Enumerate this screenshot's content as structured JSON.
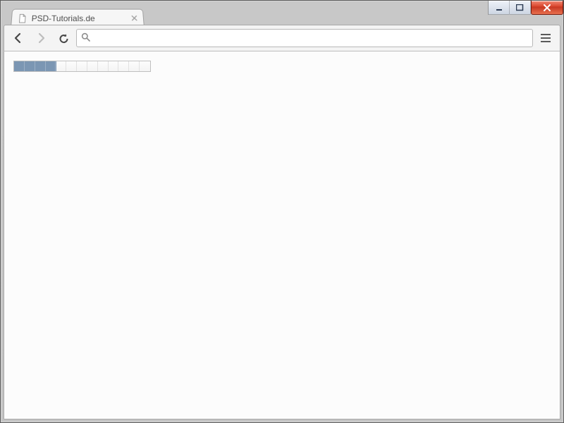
{
  "window": {
    "tab_title": "PSD-Tutorials.de"
  },
  "toolbar": {
    "address_value": "",
    "address_placeholder": ""
  },
  "page": {
    "progress": {
      "value": 4,
      "max": 13
    }
  }
}
